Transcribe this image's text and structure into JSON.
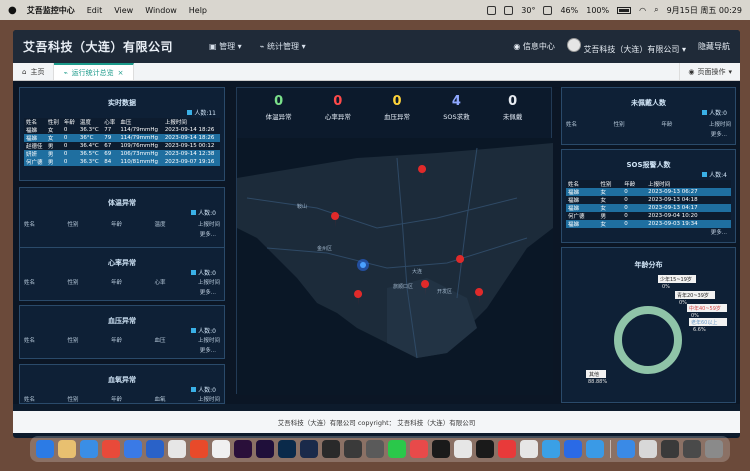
{
  "menubar": {
    "app_name": "艾吾监控中心",
    "items": [
      "Edit",
      "View",
      "Window",
      "Help"
    ],
    "temp": "30°",
    "battery": "46%",
    "zoom": "100%",
    "datetime": "9月15日 周五  00:29"
  },
  "app": {
    "title": "艾吾科技（大连）有限公司",
    "nav": [
      "管理",
      "统计管理"
    ],
    "messages": "信息中心",
    "company": "艾吾科技（大连）有限公司",
    "hide_nav": "隐藏导航"
  },
  "tabs": {
    "home": "主页",
    "active": "运行统计总览",
    "page_ops": "页面操作"
  },
  "realtime": {
    "title": "实时数据",
    "count": "人数:11",
    "columns": [
      "姓名",
      "性别",
      "年龄",
      "温度",
      "心率",
      "血压",
      "上报时间"
    ],
    "rows": [
      [
        "福娣",
        "女",
        "0",
        "36.3°C",
        "77",
        "114/79mmHg",
        "2023-09-14 18:26"
      ],
      [
        "福娣",
        "女",
        "0",
        "36°C",
        "79",
        "114/79mmHg",
        "2023-09-14 18:26"
      ],
      [
        "赵德佳",
        "男",
        "0",
        "36.4°C",
        "67",
        "109/76mmHg",
        "2023-09-15 00:12"
      ],
      [
        "妍妍",
        "男",
        "0",
        "36.5°C",
        "69",
        "106/73mmHg",
        "2023-09-14 12:38"
      ],
      [
        "何广德",
        "男",
        "0",
        "36.3°C",
        "84",
        "110/81mmHg",
        "2023-09-07 19:16"
      ]
    ]
  },
  "temp_abn": {
    "title": "体温异常",
    "count": "人数:0",
    "columns": [
      "姓名",
      "性别",
      "年龄",
      "温度",
      "上报时间"
    ],
    "more": "更多..."
  },
  "heart_abn": {
    "title": "心率异常",
    "count": "人数:0",
    "columns": [
      "姓名",
      "性别",
      "年龄",
      "心率",
      "上报时间"
    ],
    "more": "更多..."
  },
  "bp_abn": {
    "title": "血压异常",
    "count": "人数:0",
    "columns": [
      "姓名",
      "性别",
      "年龄",
      "血压",
      "上报时间"
    ],
    "more": "更多..."
  },
  "o2_abn": {
    "title": "血氧异常",
    "count": "人数:0",
    "columns": [
      "姓名",
      "性别",
      "年龄",
      "血氧",
      "上报时间"
    ],
    "more": "更多..."
  },
  "stats": [
    {
      "value": "0",
      "label": "体温异常",
      "color": "#7be08a"
    },
    {
      "value": "0",
      "label": "心率异常",
      "color": "#ff4a4a"
    },
    {
      "value": "0",
      "label": "血压异常",
      "color": "#ffd43a"
    },
    {
      "value": "4",
      "label": "SOS求救",
      "color": "#8fa8ff"
    },
    {
      "value": "0",
      "label": "未佩戴",
      "color": "#e8ecf2"
    }
  ],
  "map_labels": [
    "鞍山",
    "金州区",
    "旅顺口区",
    "大连",
    "开发区"
  ],
  "unworn": {
    "title": "未佩戴人数",
    "count": "人数:0",
    "columns": [
      "姓名",
      "性别",
      "年龄",
      "上报时间"
    ],
    "more": "更多..."
  },
  "sos": {
    "title": "SOS报警人数",
    "count": "人数:4",
    "columns": [
      "姓名",
      "性别",
      "年龄",
      "上报时间"
    ],
    "rows": [
      [
        "福娣",
        "女",
        "0",
        "2023-09-13 06:27"
      ],
      [
        "福娣",
        "女",
        "0",
        "2023-09-13 04:18"
      ],
      [
        "福娣",
        "女",
        "0",
        "2023-09-13 04:17"
      ],
      [
        "何广德",
        "男",
        "0",
        "2023-09-04 10:20"
      ],
      [
        "福娣",
        "女",
        "0",
        "2023-09-03 19:34"
      ]
    ],
    "more": "更多..."
  },
  "age": {
    "title": "年龄分布",
    "labels": [
      {
        "text": "少年15~19岁",
        "pct": "0%"
      },
      {
        "text": "青年20~39岁",
        "pct": "0%"
      },
      {
        "text": "中年40~59岁",
        "pct": "0%"
      },
      {
        "text": "老年60以上",
        "pct": "6.6%"
      },
      {
        "text": "其他",
        "pct": "88.88%"
      }
    ]
  },
  "footer": "艾吾科技（大连）有限公司 copyright： 艾吾科技（大连）有限公司",
  "colors": {
    "accent": "#1b9a8a",
    "panel": "#0e2036",
    "highlight": "#1f6fa0"
  }
}
